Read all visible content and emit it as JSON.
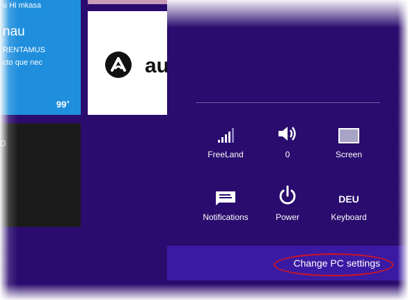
{
  "start_screen": {
    "mail_tile": {
      "header": "u Hi mkasa",
      "name": "nau",
      "line1": "RENTAMUS",
      "line2": "cto que nec",
      "count": "99",
      "count_suffix": "+"
    },
    "app_tile": {
      "icon": "audible-logo-icon",
      "brand": "au"
    },
    "dark_tile": {
      "label": "D"
    }
  },
  "settings_charm": {
    "quick_settings": [
      {
        "id": "network",
        "icon": "wifi-signal-icon",
        "label": "FreeLand"
      },
      {
        "id": "volume",
        "icon": "speaker-icon",
        "label": "0"
      },
      {
        "id": "brightness",
        "icon": "screen-icon",
        "label": "Screen"
      },
      {
        "id": "notifications",
        "icon": "notifications-icon",
        "label": "Notifications"
      },
      {
        "id": "power",
        "icon": "power-icon",
        "label": "Power"
      },
      {
        "id": "keyboard",
        "icon": "keyboard-icon",
        "label": "Keyboard",
        "icon_text": "DEU"
      }
    ],
    "change_pc_settings": "Change PC settings"
  },
  "colors": {
    "background": "#2a0b6e",
    "bottom_bar": "#3b1aa3",
    "mail_tile": "#1f8fdd",
    "highlight": "#d3141c"
  }
}
